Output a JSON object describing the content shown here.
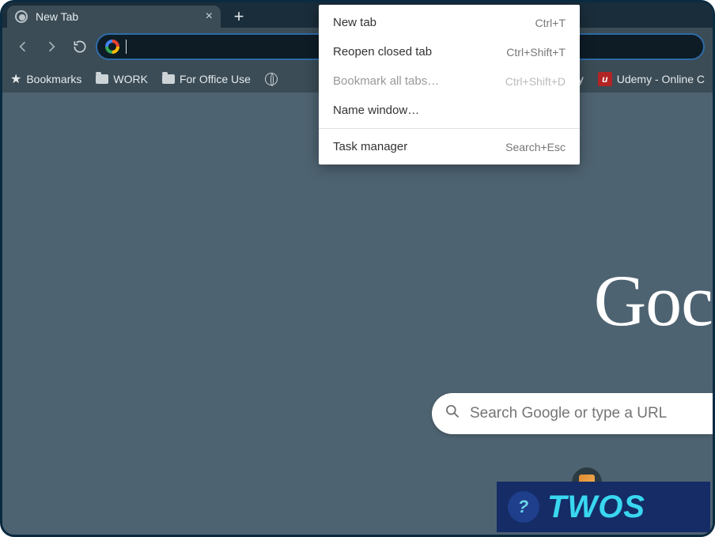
{
  "tab": {
    "title": "New Tab",
    "close": "×",
    "new_tab_plus": "+"
  },
  "toolbar": {
    "address_value": ""
  },
  "bookmarks_bar": {
    "bookmarks_label": "Bookmarks",
    "work": "WORK",
    "office": "For Office Use",
    "city_fragment": "city",
    "udemy": "Udemy - Online C"
  },
  "context_menu": {
    "items": [
      {
        "label": "New tab",
        "shortcut": "Ctrl+T",
        "disabled": false
      },
      {
        "label": "Reopen closed tab",
        "shortcut": "Ctrl+Shift+T",
        "disabled": false
      },
      {
        "label": "Bookmark all tabs…",
        "shortcut": "Ctrl+Shift+D",
        "disabled": true
      },
      {
        "label": "Name window…",
        "shortcut": "",
        "disabled": false
      }
    ],
    "section2": [
      {
        "label": "Task manager",
        "shortcut": "Search+Esc",
        "disabled": false
      }
    ]
  },
  "newtab": {
    "logo_text": "Goc",
    "search_placeholder": "Search Google or type a URL"
  },
  "watermark": {
    "text": "TWOS"
  }
}
